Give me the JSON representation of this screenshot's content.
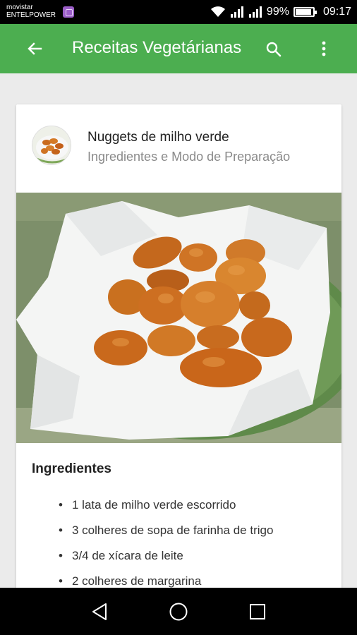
{
  "status_bar": {
    "carrier_line1": "movistar",
    "carrier_line2": "ENTELPOWER",
    "battery_percent": "99%",
    "time": "09:17",
    "icons": [
      "sim-icon",
      "wifi-icon",
      "signal-icon",
      "signal-icon",
      "battery-icon"
    ]
  },
  "app_bar": {
    "title": "Receitas Vegetárianas",
    "color": "#4cae50",
    "icons": [
      "back-arrow-icon",
      "search-icon",
      "more-vert-icon"
    ]
  },
  "card": {
    "title": "Nuggets de milho verde",
    "subtitle": "Ingredientes e Modo de Preparação",
    "image": "nuggets-photo",
    "section_heading": "Ingredientes",
    "ingredients": [
      "1 lata de milho verde escorrido",
      "3 colheres de sopa de farinha de trigo",
      "3/4 de xícara de leite",
      "2 colheres de margarina"
    ]
  },
  "nav_bar": {
    "icons": [
      "back-triangle-icon",
      "home-circle-icon",
      "recents-square-icon"
    ]
  }
}
